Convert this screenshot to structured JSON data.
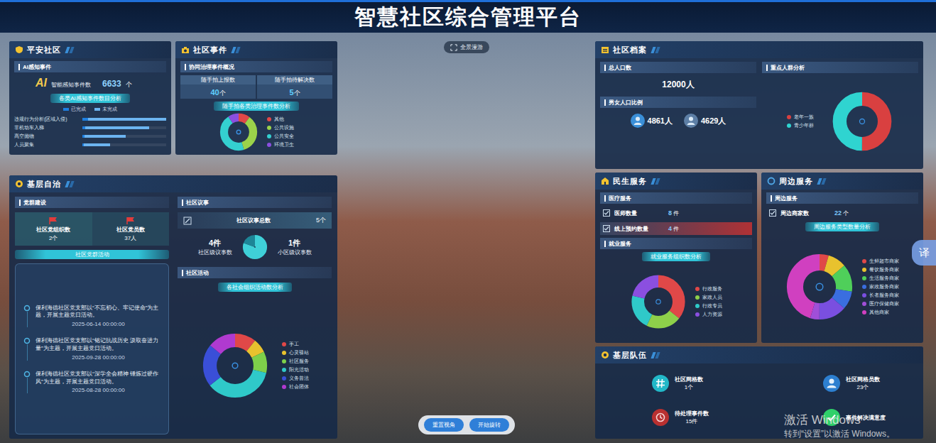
{
  "header": {
    "title": "智慧社区综合管理平台"
  },
  "scene": {
    "tour_button": "全景漫游",
    "buttons": [
      "重置视角",
      "开始旋转"
    ],
    "translate_button": "译"
  },
  "watermark": {
    "title": "激活 Windows",
    "subtitle": "转到“设置”以激活 Windows。"
  },
  "safe_community": {
    "title": "平安社区",
    "section": "AI感知事件",
    "ai_badge": "AI",
    "ai_label": "智能感知事件数",
    "ai_value": "6633",
    "ai_unit": "个",
    "chart_title": "各类AI感知事件数目分析",
    "legend": [
      {
        "label": "已完成",
        "color": "#1e7fe0"
      },
      {
        "label": "未完成",
        "color": "#6cb4f0"
      }
    ],
    "bars": [
      {
        "label": "违规行为分析(区域入侵)",
        "values": [
          160,
          2340
        ]
      },
      {
        "label": "非机动车入梯",
        "values": [
          90,
          1910
        ]
      },
      {
        "label": "高空抛物",
        "values": [
          60,
          1240
        ]
      },
      {
        "label": "人员聚集",
        "values": [
          40,
          793
        ]
      }
    ]
  },
  "community_events": {
    "title": "社区事件",
    "section": "协同治理事件概况",
    "stats": [
      {
        "label": "随手拍上报数",
        "value": "40",
        "unit": "个"
      },
      {
        "label": "随手拍待解决数",
        "value": "5",
        "unit": "个"
      }
    ],
    "chart_title": "随手拍各类治理事件数分析",
    "legend": [
      {
        "label": "其他",
        "color": "#e04848",
        "value": 4
      },
      {
        "label": "公共设施",
        "color": "#9bd34a",
        "value": 14
      },
      {
        "label": "公共安全",
        "color": "#34d0d0",
        "value": 18
      },
      {
        "label": "环境卫生",
        "color": "#8b4fe0",
        "value": 4
      }
    ]
  },
  "self_governance": {
    "title": "基层自治",
    "party": {
      "section": "党群建设",
      "stats": [
        {
          "label": "社区党组织数",
          "value": "2个"
        },
        {
          "label": "社区党员数",
          "value": "37人"
        }
      ],
      "activity_title": "社区党群活动",
      "timeline": [
        {
          "text": "保利海德社区党支部以“不忘初心、牢记使命”为主题，开展主题党日活动。",
          "time": "2025-06-14 00:00:00"
        },
        {
          "text": "保利海德社区党支部以“铭记抗战历史 汲取奋进力量”为主题，开展主题党日活动。",
          "time": "2025-09-28 00:00:00"
        },
        {
          "text": "保利海德社区党支部以“深学全会精神 锤炼过硬作风”为主题，开展主题党日活动。",
          "time": "2025-08-28 00:00:00"
        }
      ]
    },
    "council": {
      "section": "社区议事",
      "total_label": "社区议事总数",
      "total_value": "5个",
      "levels": [
        {
          "text": "4件",
          "label": "社区级议事数",
          "value": 4,
          "color": "#3fd0d8"
        },
        {
          "text": "1件",
          "label": "小区级议事数",
          "value": 1,
          "color": "#1d8597"
        }
      ]
    },
    "activities": {
      "section": "社区活动",
      "chart_title": "各社会组织活动数分析",
      "legend": [
        {
          "label": "手工",
          "color": "#e04848",
          "value": 3
        },
        {
          "label": "心灵驿站",
          "color": "#e8c22e",
          "value": 2
        },
        {
          "label": "社区服务",
          "color": "#7ed04a",
          "value": 3
        },
        {
          "label": "阳光活动",
          "color": "#2fc9c9",
          "value": 10
        },
        {
          "label": "义务普法",
          "color": "#3a4fd8",
          "value": 6
        },
        {
          "label": "社会团体",
          "color": "#b03ad0",
          "value": 4
        }
      ]
    }
  },
  "archive": {
    "title": "社区档案",
    "population_section": "总人口数",
    "population": "12000人",
    "ratio_section": "男女人口比例",
    "genders": [
      {
        "value": "4861人",
        "kind": "male"
      },
      {
        "value": "4629人",
        "kind": "female"
      }
    ],
    "key_groups": {
      "section": "重点人群分析",
      "legend": [
        {
          "label": "老年一族",
          "color": "#d94040",
          "value": 50
        },
        {
          "label": "青少年群",
          "color": "#2fd4d0",
          "value": 50
        }
      ]
    }
  },
  "livelihood": {
    "title": "民生服务",
    "medical_section": "医疗服务",
    "medical_rows": [
      {
        "label": "医师数量",
        "value": "8",
        "unit": "件",
        "highlight": false
      },
      {
        "label": "线上预约数量",
        "value": "4",
        "unit": "件",
        "highlight": true
      }
    ],
    "employment_section": "就业服务",
    "chart_title": "就业服务组织数分析",
    "legend": [
      {
        "label": "行政服务",
        "color": "#e04848",
        "value": 5
      },
      {
        "label": "家政人员",
        "color": "#8ed04a",
        "value": 3
      },
      {
        "label": "行政专员",
        "color": "#2fc9c9",
        "value": 3
      },
      {
        "label": "人力资源",
        "color": "#8b4fe0",
        "value": 3
      }
    ]
  },
  "nearby": {
    "title": "周边服务",
    "section": "周边服务",
    "row": {
      "label": "周边商家数",
      "value": "22",
      "unit": "个"
    },
    "chart_title": "周边服务类型数量分析",
    "legend": [
      {
        "label": "生鲜超市商家",
        "color": "#e04848",
        "value": 1
      },
      {
        "label": "餐饮服务商家",
        "color": "#e8c22e",
        "value": 2
      },
      {
        "label": "生活服务商家",
        "color": "#4fcf5a",
        "value": 3
      },
      {
        "label": "家政服务商家",
        "color": "#3a6ee0",
        "value": 2
      },
      {
        "label": "长者服务商家",
        "color": "#7a4fe0",
        "value": 3
      },
      {
        "label": "医疗保健商家",
        "color": "#a04fd8",
        "value": 1
      },
      {
        "label": "其他商家",
        "color": "#d040c0",
        "value": 10
      }
    ]
  },
  "team": {
    "title": "基层队伍",
    "items": [
      {
        "label": "社区网格数",
        "value": "1个",
        "kind": "grid"
      },
      {
        "label": "社区网格员数",
        "value": "23个",
        "kind": "person"
      },
      {
        "label": "待处理事件数",
        "value": "15件",
        "kind": "pending"
      },
      {
        "label": "事件解决满意度",
        "kind": "satisfaction"
      }
    ]
  }
}
